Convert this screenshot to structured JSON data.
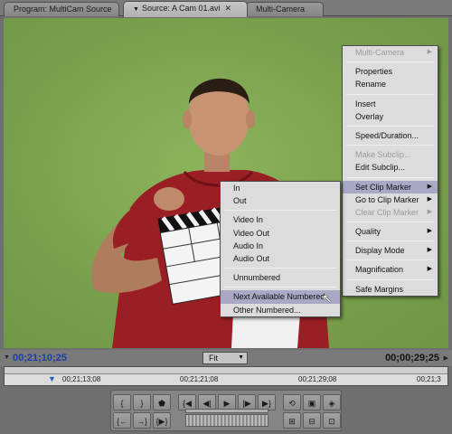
{
  "tabs": [
    {
      "label": "Program: MultiCam Source",
      "active": false
    },
    {
      "label": "Source: A Cam 01.avi",
      "active": true,
      "has_close": true
    },
    {
      "label": "Multi-Camera",
      "active": false
    }
  ],
  "context_menu": {
    "items": [
      {
        "label": "Multi-Camera",
        "disabled": true,
        "submenu": true
      },
      {
        "sep": true
      },
      {
        "label": "Properties"
      },
      {
        "label": "Rename"
      },
      {
        "sep": true
      },
      {
        "label": "Insert"
      },
      {
        "label": "Overlay"
      },
      {
        "sep": true
      },
      {
        "label": "Speed/Duration..."
      },
      {
        "sep": true
      },
      {
        "label": "Make Subclip...",
        "disabled": true
      },
      {
        "label": "Edit Subclip..."
      },
      {
        "sep": true
      },
      {
        "label": "Set Clip Marker",
        "submenu": true,
        "highlighted": true
      },
      {
        "label": "Go to Clip Marker",
        "submenu": true
      },
      {
        "label": "Clear Clip Marker",
        "disabled": true,
        "submenu": true
      },
      {
        "sep": true
      },
      {
        "label": "Quality",
        "submenu": true
      },
      {
        "sep": true
      },
      {
        "label": "Display Mode",
        "submenu": true
      },
      {
        "sep": true
      },
      {
        "label": "Magnification",
        "submenu": true
      },
      {
        "sep": true
      },
      {
        "label": "Safe Margins"
      }
    ]
  },
  "submenu": {
    "items": [
      {
        "label": "In"
      },
      {
        "label": "Out"
      },
      {
        "sep": true
      },
      {
        "label": "Video In"
      },
      {
        "label": "Video Out"
      },
      {
        "label": "Audio In"
      },
      {
        "label": "Audio Out"
      },
      {
        "sep": true
      },
      {
        "label": "Unnumbered"
      },
      {
        "sep": true
      },
      {
        "label": "Next Available Numbered",
        "highlighted": true
      },
      {
        "label": "Other Numbered..."
      }
    ]
  },
  "timebar": {
    "current_timecode": "00;21;10;25",
    "duration_timecode": "00;00;29;25",
    "zoom": "Fit"
  },
  "ruler": {
    "labels": [
      "00;21;13;08",
      "00;21;21;08",
      "00;21;29;08",
      "00;21;3"
    ]
  },
  "colors": {
    "green_screen": "#7ea64f",
    "timecode_blue": "#1a3fa8",
    "menu_bg": "#dcdcdc",
    "menu_highlight": "#a9a9c6"
  }
}
